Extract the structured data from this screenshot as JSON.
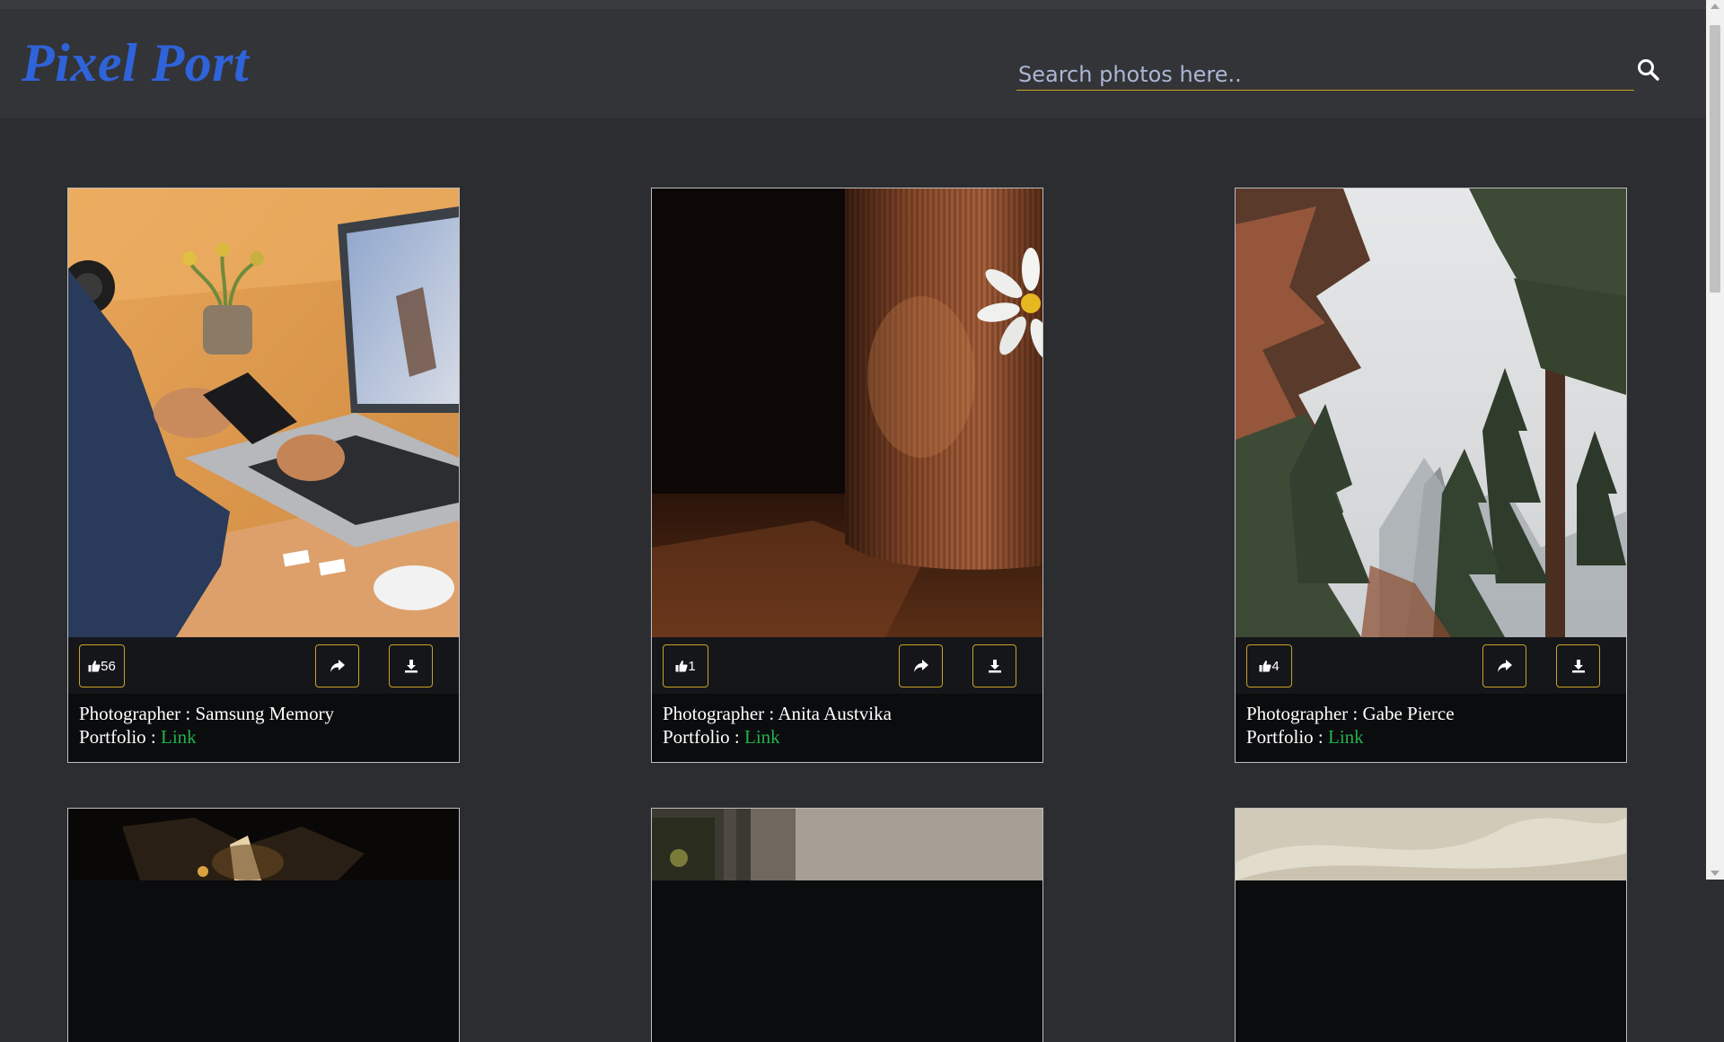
{
  "app": {
    "logo": "Pixel Port"
  },
  "search": {
    "placeholder": "Search photos here..",
    "icon": "search-icon"
  },
  "labels": {
    "photographer_prefix": "Photographer : ",
    "portfolio_prefix": "Portfolio : "
  },
  "colors": {
    "accent": "#c9a227",
    "brand": "#2f63d9",
    "link": "#22b24c",
    "background": "#2c2d30"
  },
  "cards": [
    {
      "likes": "56",
      "photographer": "Samsung Memory",
      "portfolio_link": "Link"
    },
    {
      "likes": "1",
      "photographer": "Anita Austvika",
      "portfolio_link": "Link"
    },
    {
      "likes": "4",
      "photographer": "Gabe Pierce",
      "portfolio_link": "Link"
    }
  ]
}
